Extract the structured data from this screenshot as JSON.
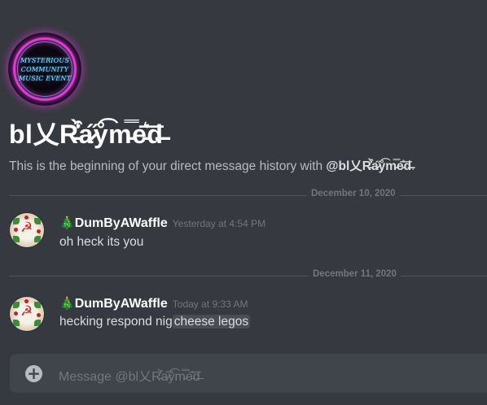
{
  "channel": {
    "avatar_text": [
      "MYSTERIOUS",
      "COMMUNITY",
      "MUSIC EVENT"
    ],
    "title": "bl乂R̵͒̾̀a̷̋ẙ͡m̵̿e̵͛͞d̶",
    "intro_prefix": "This is the beginning of your direct message history with ",
    "intro_user": "@bl乂R̵͒̾̀a̷̋ẙ͡m̵̿e̵͛͞d̶",
    "intro_suffix": "."
  },
  "dividers": [
    {
      "date": "December 10, 2020"
    },
    {
      "date": "December 11, 2020"
    }
  ],
  "messages": [
    {
      "emoji": "🎄",
      "author": "DumByAWaffle",
      "timestamp": "Yesterday at 4:54 PM",
      "text": "oh heck its you",
      "highlight": ""
    },
    {
      "emoji": "🎄",
      "author": "DumByAWaffle",
      "timestamp": "Today at 9:33 AM",
      "text": "hecking respond nig",
      "highlight": "cheese legos"
    }
  ],
  "composer": {
    "placeholder": "Message @bl乂R̵͒̾̀a̷̋ẙ͡m̵̿e̵͛͞d̶",
    "add_icon": "plus-circle-icon"
  },
  "colors": {
    "background": "#36393f",
    "composer_bg": "#40444b",
    "username": "#ffffff",
    "timestamp": "#72767d",
    "divider": "#4f545c"
  }
}
